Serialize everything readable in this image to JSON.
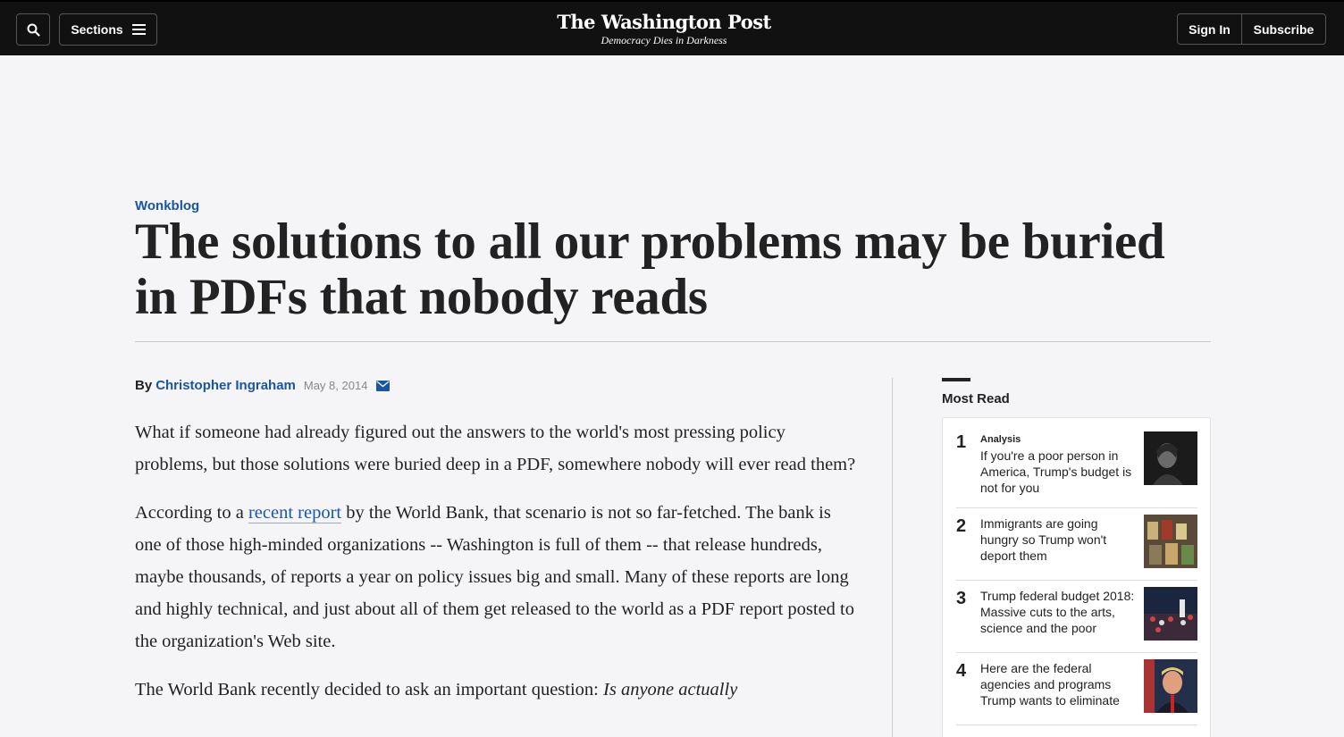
{
  "header": {
    "sections_label": "Sections",
    "logo_name": "The Washington Post",
    "logo_tagline": "Democracy Dies in Darkness",
    "signin_label": "Sign In",
    "subscribe_label": "Subscribe"
  },
  "article": {
    "kicker": "Wonkblog",
    "headline": "The solutions to all our problems may be buried in PDFs that nobody reads",
    "byline_prefix": "By",
    "author": "Christopher Ingraham",
    "date": "May 8, 2014",
    "p1": "What if someone had already figured out the answers to the world's most pressing policy problems, but those solutions were buried deep in a PDF, somewhere nobody will ever read them?",
    "p2_before": "According to a ",
    "p2_link": "recent report",
    "p2_after": " by the World Bank, that scenario is not so far-fetched. The bank is one of those high-minded organizations -- Washington is full of them -- that release hundreds, maybe thousands, of reports a year on policy issues big and small. Many of these reports are long and highly technical, and just about all of them get released to the world as a PDF report posted to the organization's Web site.",
    "p3_before": "The World Bank recently decided to ask an important question: ",
    "p3_italic": "Is anyone actually"
  },
  "most_read": {
    "title": "Most Read",
    "items": [
      {
        "num": "1",
        "label": "Analysis",
        "text": "If you're a poor person in America, Trump's budget is not for you"
      },
      {
        "num": "2",
        "label": "",
        "text": "Immigrants are going hungry so Trump won't deport them"
      },
      {
        "num": "3",
        "label": "",
        "text": "Trump federal budget 2018: Massive cuts to the arts, science and the poor"
      },
      {
        "num": "4",
        "label": "",
        "text": "Here are the federal agencies and programs Trump wants to eliminate"
      }
    ]
  },
  "colors": {
    "accent": "#1955a5",
    "topbar": "#111111",
    "background": "#f5f5f7"
  }
}
